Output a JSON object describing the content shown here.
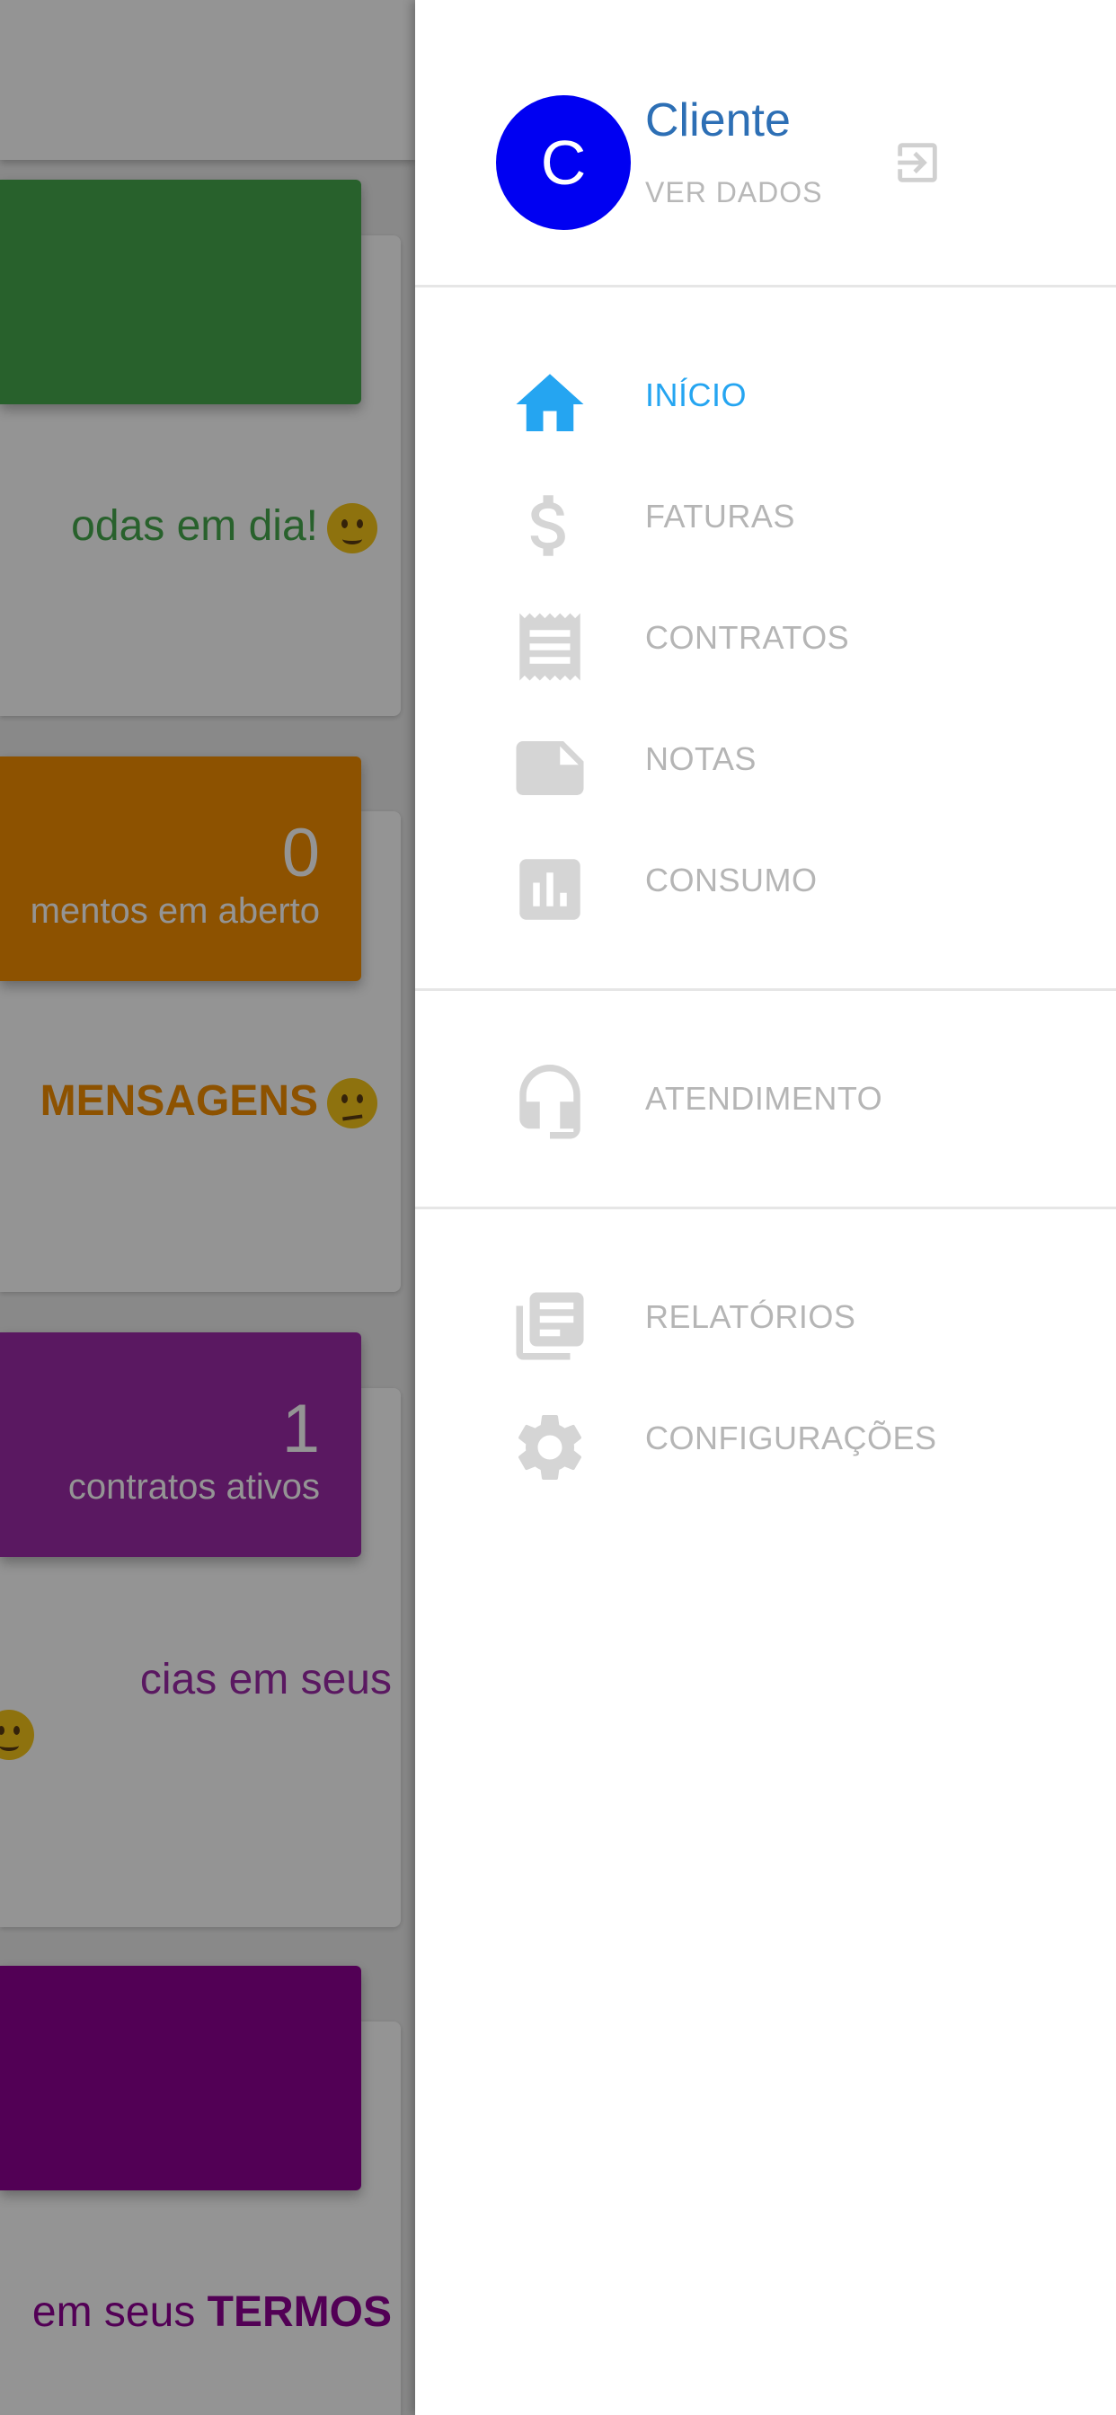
{
  "colors": {
    "accent": "#25a5f1",
    "inactive": "#b5b5b5",
    "avatar_bg": "#0000f2",
    "user_name": "#2d6fb5",
    "card_green": "#46a84c",
    "card_orange": "#f38e00",
    "card_purple": "#9b2aa8",
    "card_dark_purple": "#8e0093"
  },
  "background": {
    "cards": [
      {
        "message": "odas em dia!",
        "emoji": "wink-emoji"
      },
      {
        "number": "0",
        "subtitle": "mentos em aberto",
        "message": "MENSAGENS",
        "emoji": "confused-emoji"
      },
      {
        "number": "1",
        "subtitle": "contratos ativos",
        "message": "cias em seus",
        "emoji": "grin-emoji"
      },
      {
        "message_prefix": "em seus ",
        "message_bold": "TERMOS"
      }
    ]
  },
  "drawer": {
    "avatar_letter": "C",
    "user_name": "Cliente",
    "view_data": "VER DADOS",
    "logout_icon": "logout-icon",
    "menu": [
      {
        "label": "INÍCIO",
        "icon": "home-icon",
        "active": true
      },
      {
        "label": "FATURAS",
        "icon": "dollar-icon",
        "active": false
      },
      {
        "label": "CONTRATOS",
        "icon": "receipt-icon",
        "active": false
      },
      {
        "label": "NOTAS",
        "icon": "note-icon",
        "active": false
      },
      {
        "label": "CONSUMO",
        "icon": "chart-icon",
        "active": false
      }
    ],
    "support": [
      {
        "label": "ATENDIMENTO",
        "icon": "headset-icon",
        "active": false
      }
    ],
    "extras": [
      {
        "label": "RELATÓRIOS",
        "icon": "reports-icon",
        "active": false
      },
      {
        "label": "CONFIGURAÇÕES",
        "icon": "gear-icon",
        "active": false
      }
    ]
  }
}
